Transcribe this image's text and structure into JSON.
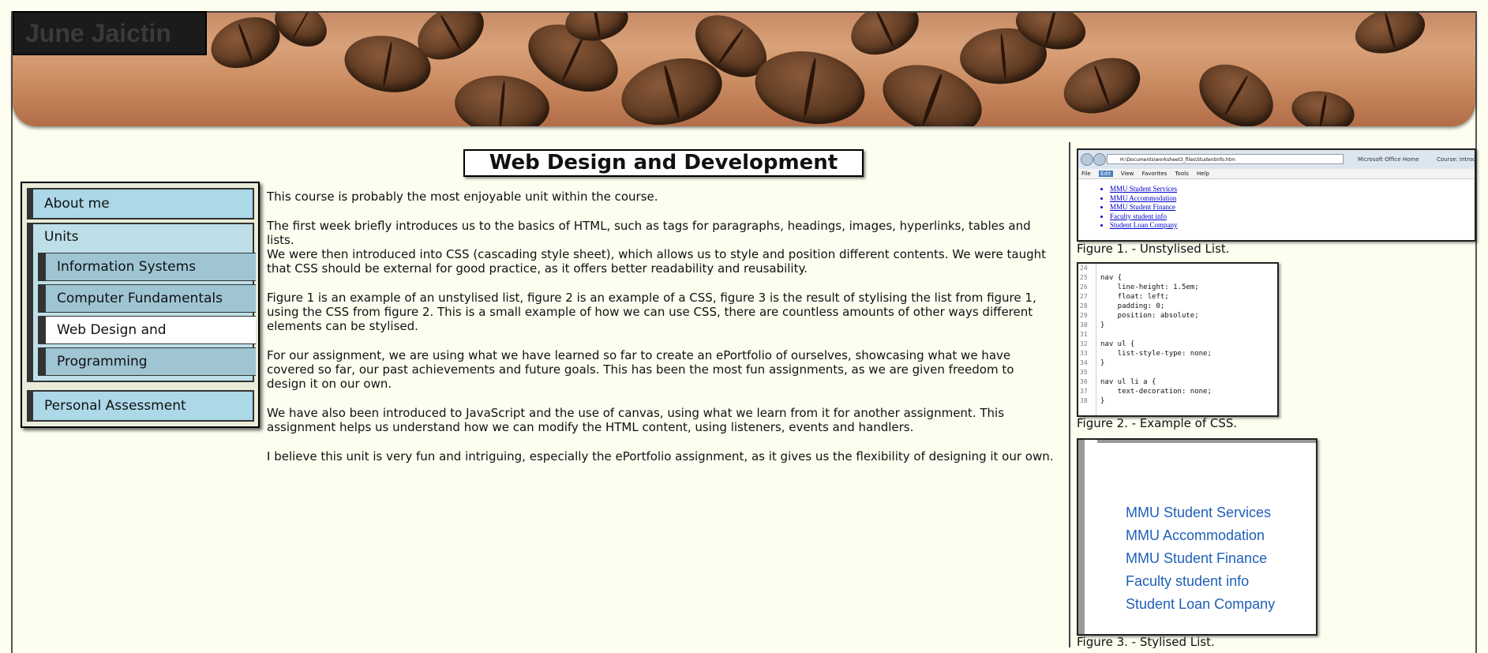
{
  "site": {
    "title": "June Jaictin"
  },
  "page": {
    "heading": "Web Design and Development"
  },
  "nav": {
    "about": "About me",
    "units_label": "Units",
    "units": [
      {
        "label": "Information Systems"
      },
      {
        "label": "Computer Fundamentals"
      },
      {
        "label": "Web Design and Development",
        "active": true
      },
      {
        "label": "Programming"
      }
    ],
    "assessment": "Personal Assessment"
  },
  "content": {
    "paragraphs": [
      "This course is probably the most enjoyable unit within the course.",
      "The first week briefly introduces us to the basics of HTML, such as tags for paragraphs, headings, images, hyperlinks, tables and lists.",
      "We were then introduced into CSS (cascading style sheet), which allows us to style and position different contents. We were taught that CSS should be external for good practice, as it offers better readability and reusability.",
      "Figure 1 is an example of an unstylised list, figure 2 is an example of a CSS, figure 3 is the result of stylising the list from figure 1, using the CSS from figure 2. This is a small example of how we can use CSS, there are countless amounts of other ways different elements can be stylised.",
      "For our assignment, we are using what we have learned so far to create an ePortfolio of ourselves, showcasing what we have covered so far, our past achievements and future goals. This has been the most fun assignments, as we are given freedom to design it on our own.",
      "We have also been introduced to JavaScript and the use of canvas, using what we learn from it for another assignment. This assignment helps us understand how we can modify the HTML content, using listeners, events and handlers.",
      "I believe this unit is very fun and intriguing, especially the ePortfolio assignment, as it gives us the flexibility of designing it our own."
    ]
  },
  "figures": {
    "fig1": {
      "caption": "Figure 1. - Unstylised List.",
      "address": "H:\\Documents\\worksheet3_files\\StudentInfo.htm",
      "tab1": "Microsoft Office Home",
      "tab2": "Course: Introducti",
      "menu": [
        "File",
        "Edit",
        "View",
        "Favorites",
        "Tools",
        "Help"
      ],
      "items": [
        "MMU Student Services",
        "MMU Accommodation",
        "MMU Student Finance",
        "Faculty student info",
        "Student Loan Company"
      ]
    },
    "fig2": {
      "caption": "Figure 2. - Example of CSS.",
      "lines": [
        {
          "n": "24",
          "t": ""
        },
        {
          "n": "25",
          "t": "nav {"
        },
        {
          "n": "26",
          "t": "    line-height: 1.5em;"
        },
        {
          "n": "27",
          "t": "    float: left;"
        },
        {
          "n": "28",
          "t": "    padding: 0;"
        },
        {
          "n": "29",
          "t": "    position: absolute;"
        },
        {
          "n": "30",
          "t": "}"
        },
        {
          "n": "31",
          "t": ""
        },
        {
          "n": "32",
          "t": "nav ul {"
        },
        {
          "n": "33",
          "t": "    list-style-type: none;"
        },
        {
          "n": "34",
          "t": "}"
        },
        {
          "n": "35",
          "t": ""
        },
        {
          "n": "36",
          "t": "nav ul li a {"
        },
        {
          "n": "37",
          "t": "    text-decoration: none;"
        },
        {
          "n": "38",
          "t": "}"
        }
      ]
    },
    "fig3": {
      "caption": "Figure 3. - Stylised List.",
      "items": [
        "MMU Student Services",
        "MMU Accommodation",
        "MMU Student Finance",
        "Faculty student info",
        "Student Loan Company"
      ]
    }
  }
}
